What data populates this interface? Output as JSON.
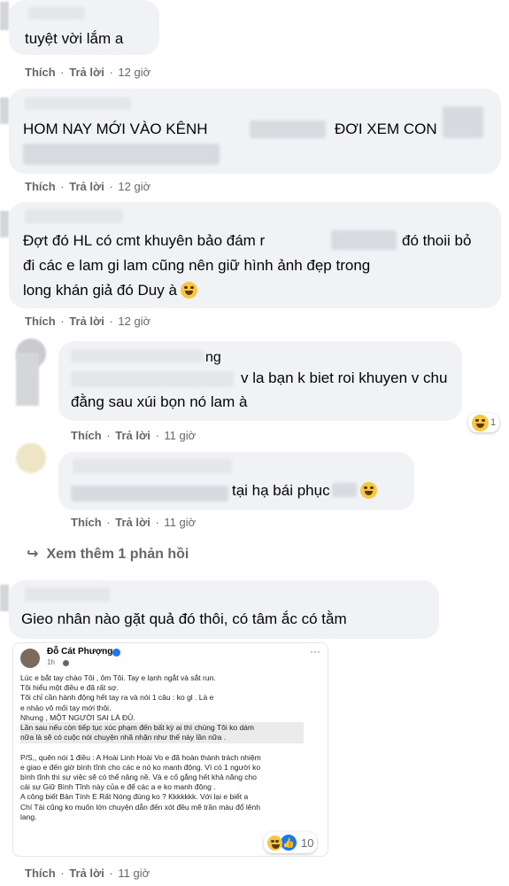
{
  "comments": [
    {
      "text": "tuyệt vời lắm a",
      "like": "Thích",
      "reply": "Trả lời",
      "time": "12 giờ"
    },
    {
      "text_a": "HOM NAY MỚI VÀO KÊNH",
      "text_b": "ĐƠI XEM CON",
      "like": "Thích",
      "reply": "Trả lời",
      "time": "12 giờ"
    },
    {
      "line1_a": "Đợt đó HL có cmt khuyên bảo đám r",
      "line1_b": "đó thoii bỏ",
      "line2": "đi các e lam gi lam cũng nên giữ hình ảnh đẹp trong",
      "line3": "long khán giả đó Duy à",
      "like": "Thích",
      "reply": "Trả lời",
      "time": "12 giờ"
    },
    {
      "name_tail": "ng",
      "line1": "v la bạn k biet roi khuyen v chu",
      "line2": "đằng sau xúi bọn nó lam à",
      "like": "Thích",
      "reply": "Trả lời",
      "time": "11 giờ"
    },
    {
      "text": "tại hạ bái phục",
      "like": "Thích",
      "reply": "Trả lời",
      "time": "11 giờ"
    },
    {
      "text": "Gieo nhân nào gặt quả đó thôi, có tâm ắc có tằm",
      "like": "Thích",
      "reply": "Trả lời",
      "time": "11 giờ",
      "reaction_count": "10"
    }
  ],
  "see_more": {
    "icon": "reply-arrow-icon",
    "label": "Xem thêm 1 phản hồi"
  },
  "embed": {
    "author": "Đỗ Cát Phượng",
    "time": "1h",
    "more": "···",
    "lines": [
      "Lúc e bắt tay chào Tôi , ôm Tôi. Tay e lạnh ngắt và sắt run.",
      "Tôi hiểu một điều e đã rất sợ.",
      "Tôi chỉ cần hành động hết tay        ra và nói 1 câu : ko              gl        . Là e",
      "e nhảo vô        mối tay mới thôi.",
      "Nhưng , MỘT NGƯỜI SAI LÀ ĐỦ.",
      "Lần sau nếu còn tiếp tục xúc phạm đến bất kỳ ai thì chúng Tôi ko dám",
      "nữa là sẽ có cuộc nói chuyện nhã nhặn như thế này lần nữa .",
      "",
      "P/S,, quên nói 1 điều : A Hoài Linh Hoài Vo e đã hoàn thành trách nhiệm",
      "e giao e đến giờ bình tĩnh cho các e nó ko manh động. Vì có 1 người ko",
      "bình tĩnh thì sự việc sẽ có thể nâng nề. Và e cố gắng hết khả năng cho",
      "cái sự Giữ Bình Tĩnh  này của e để các a e ko manh động .",
      "A công biết Bản Tính E Rất Nóng  đúng ko ? Kkkkkkk. Với lại e biết a",
      "Chí Tài cũng ko muốn lớn chuyện dẫn đến xót đều mẽ trần màu đổ lênh",
      "lang."
    ]
  },
  "colors": {
    "bubble": "#f0f2f5",
    "meta": "#65676b",
    "text": "#050505",
    "link": "#1877f2"
  }
}
